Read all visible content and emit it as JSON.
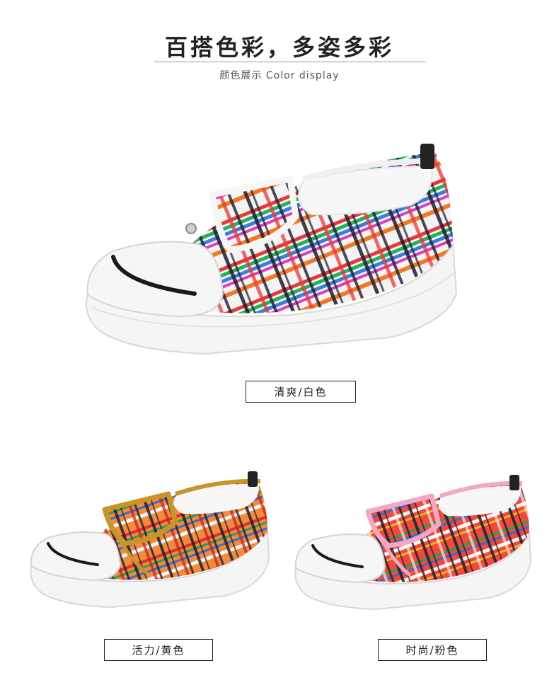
{
  "header": {
    "title": "百搭色彩，多姿多彩",
    "subtitle": "颜色展示 Color display"
  },
  "products": [
    {
      "label": "清爽/白色",
      "trim_color": "#f4f4f4"
    },
    {
      "label": "活力/黄色",
      "trim_color": "#c8952c"
    },
    {
      "label": "时尚/粉色",
      "trim_color": "#f2a7c8"
    }
  ]
}
